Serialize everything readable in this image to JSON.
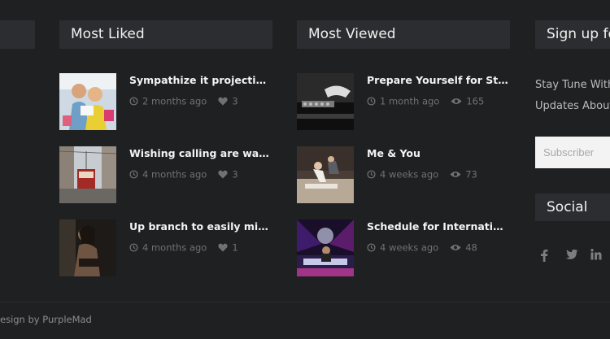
{
  "widgets": {
    "most_liked": {
      "title": "Most Liked",
      "posts": [
        {
          "title": "Sympathize it projection ye in...",
          "date": "2 months ago",
          "count": "3"
        },
        {
          "title": "Wishing calling are warrant",
          "date": "4 months ago",
          "count": "3"
        },
        {
          "title": "Up branch to easily missed by ...",
          "date": "4 months ago",
          "count": "1"
        }
      ]
    },
    "most_viewed": {
      "title": "Most Viewed",
      "posts": [
        {
          "title": "Prepare Yourself for Studio Re...",
          "date": "1 month ago",
          "count": "165"
        },
        {
          "title": "Me & You",
          "date": "4 weeks ago",
          "count": "73"
        },
        {
          "title": "Schedule for International the...",
          "date": "4 weeks ago",
          "count": "48"
        }
      ]
    },
    "signup": {
      "title": "Sign up for",
      "text_line1": "Stay Tune With",
      "text_line2": "Updates About",
      "placeholder": "Subscriber"
    },
    "social": {
      "title": "Social",
      "icons": [
        "facebook-icon",
        "twitter-icon",
        "linkedin-icon",
        "dribbble-icon"
      ]
    }
  },
  "footer": {
    "text": "esign by PurpleMad"
  },
  "colors": {
    "background": "#1f2022",
    "header": "#2c2d30",
    "meta": "#6f7175"
  }
}
